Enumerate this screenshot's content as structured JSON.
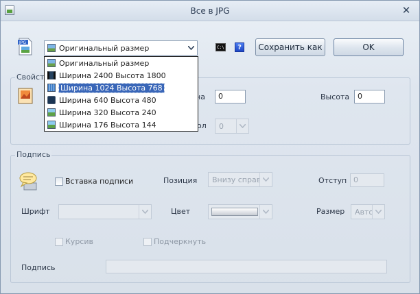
{
  "window": {
    "title": "Все в JPG",
    "close_glyph": "✕"
  },
  "toolbar": {
    "size_combo_value": "Оригинальный размер",
    "cmd_icon_text": "C:\\",
    "help_icon_text": "?",
    "save_as_label": "Сохранить как",
    "ok_label": "OK"
  },
  "size_dropdown": {
    "items": [
      {
        "label": "Оригинальный размер",
        "icon": "image-icon"
      },
      {
        "label": "Ширина 2400 Высота 1800",
        "icon": "film-icon"
      },
      {
        "label": "Ширина 1024 Высота 768",
        "icon": "monitor-icon",
        "selected": true
      },
      {
        "label": "Ширина 640 Высота 480",
        "icon": "phone-icon"
      },
      {
        "label": "Ширина 320 Высота 240",
        "icon": "picture-icon"
      },
      {
        "label": "Ширина 176 Высота 144",
        "icon": "picture-icon"
      }
    ]
  },
  "properties": {
    "group_title": "Свойст",
    "width_label_partial": "на",
    "width_value": "0",
    "height_label": "Высота",
    "height_value": "0",
    "hidden_label_partial": "ол",
    "hidden_combo_value": "0"
  },
  "caption": {
    "group_title": "Подпись",
    "insert_caption_label": "Вставка подписи",
    "position_label": "Позиция",
    "position_value": "Внизу справа",
    "indent_label": "Отступ",
    "indent_value": "0",
    "font_label": "Шрифт",
    "font_value": "",
    "color_label": "Цвет",
    "size_label": "Размер",
    "size_value": "Авто",
    "italic_label": "Курсив",
    "underline_label": "Подчеркнуть",
    "caption_text_label": "Подпись",
    "caption_text_value": ""
  }
}
